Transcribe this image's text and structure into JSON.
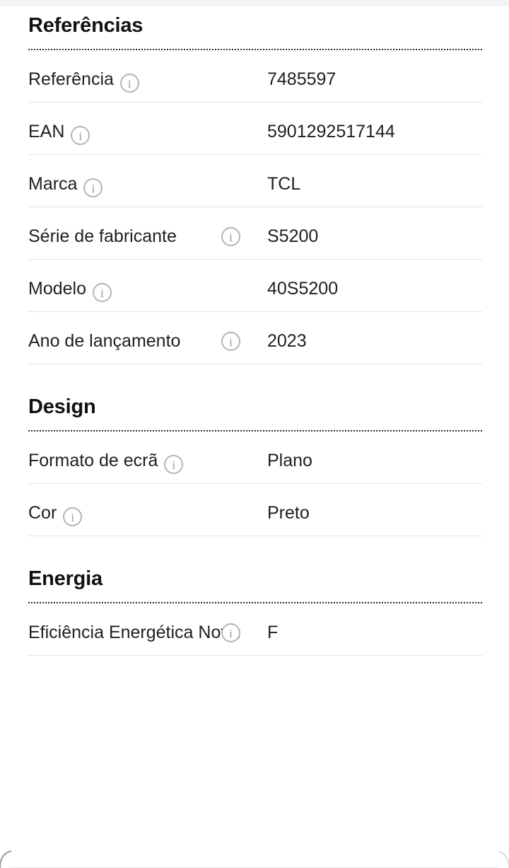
{
  "theme": {
    "background": "#ffffff",
    "page_strip": "#f4f4f4",
    "text": "#1f1f1f",
    "heading": "#111111",
    "divider": "#e3e3e3",
    "dotted_divider": "#2b2b2b",
    "icon_border": "#b4b4b4",
    "icon_glyph": "#9a9a9a"
  },
  "icons": {
    "info": "info-icon",
    "info_glyph": "i"
  },
  "sections": [
    {
      "title": "Referências",
      "rows": [
        {
          "label": "Referência",
          "value": "7485597",
          "wrap": false
        },
        {
          "label": "EAN",
          "value": "5901292517144",
          "wrap": false
        },
        {
          "label": "Marca",
          "value": "TCL",
          "wrap": false
        },
        {
          "label": "Série de fabricante",
          "value": "S5200",
          "wrap": true
        },
        {
          "label": "Modelo",
          "value": "40S5200",
          "wrap": false
        },
        {
          "label": "Ano de lançamento",
          "value": "2023",
          "wrap": true
        }
      ]
    },
    {
      "title": "Design",
      "rows": [
        {
          "label": "Formato de ecrã",
          "value": "Plano",
          "wrap": false
        },
        {
          "label": "Cor",
          "value": "Preto",
          "wrap": false
        }
      ]
    },
    {
      "title": "Energia",
      "rows": [
        {
          "label": "Eficiência Energética Nova",
          "value": "F",
          "wrap": true
        }
      ]
    }
  ]
}
